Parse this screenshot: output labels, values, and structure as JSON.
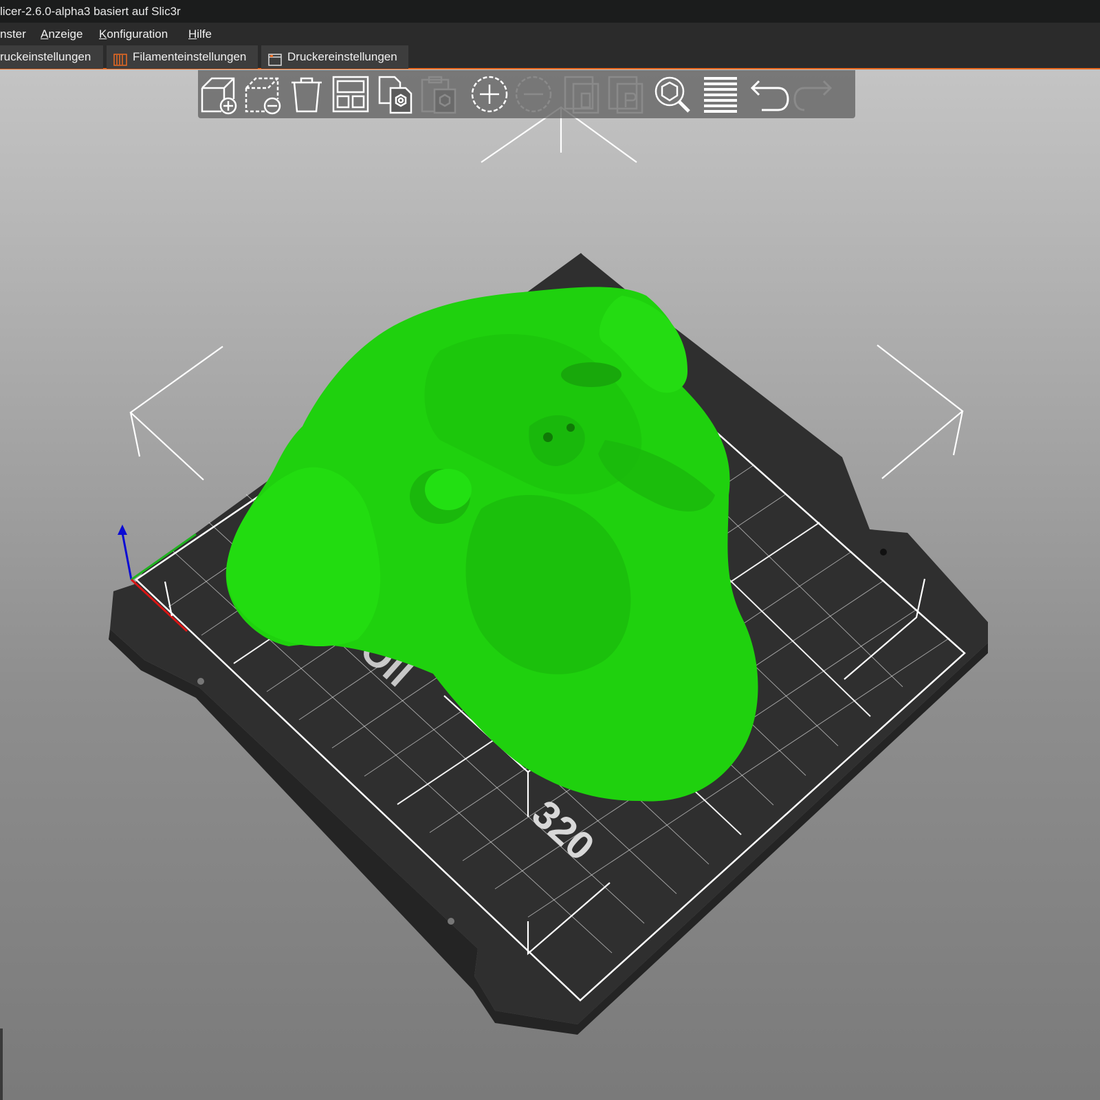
{
  "window": {
    "title": "licer-2.6.0-alpha3 basiert auf Slic3r"
  },
  "menu": {
    "items": [
      {
        "label": "nster",
        "accel": ""
      },
      {
        "label": "nzeige",
        "accel": "A"
      },
      {
        "label": "onfiguration",
        "accel": "K"
      },
      {
        "label": "ilfe",
        "accel": "H"
      }
    ]
  },
  "tabs": [
    {
      "label": "ruckeinstellungen",
      "icon": "print-settings-icon"
    },
    {
      "label": "Filamenteinstellungen",
      "icon": "filament-icon"
    },
    {
      "label": "Druckereinstellungen",
      "icon": "printer-icon"
    }
  ],
  "toolbar": {
    "tools": [
      {
        "name": "add-object",
        "icon": "add-cube-icon",
        "enabled": true
      },
      {
        "name": "delete",
        "icon": "delete-cube-icon",
        "enabled": true
      },
      {
        "name": "delete-all",
        "icon": "trash-icon",
        "enabled": true
      },
      {
        "name": "arrange",
        "icon": "arrange-icon",
        "enabled": true
      },
      {
        "name": "copy",
        "icon": "copy-icon",
        "enabled": true
      },
      {
        "name": "paste",
        "icon": "paste-icon",
        "enabled": false
      },
      {
        "name": "add-instance",
        "icon": "plus-circle-icon",
        "enabled": true
      },
      {
        "name": "remove-instance",
        "icon": "minus-circle-icon",
        "enabled": false
      },
      {
        "name": "split-objects",
        "icon": "split-objects-icon",
        "enabled": false
      },
      {
        "name": "split-parts",
        "icon": "split-parts-icon",
        "enabled": false
      },
      {
        "name": "search",
        "icon": "search-icon",
        "enabled": true
      },
      {
        "name": "layers-editing",
        "icon": "layers-icon",
        "enabled": true
      },
      {
        "name": "undo",
        "icon": "undo-icon",
        "enabled": true
      },
      {
        "name": "redo",
        "icon": "redo-icon",
        "enabled": false
      }
    ]
  },
  "bed": {
    "label": "320"
  },
  "colors": {
    "accent": "#ed6b21",
    "model": "#1fd10e",
    "bed": "#333333",
    "grid": "#ffffff"
  }
}
